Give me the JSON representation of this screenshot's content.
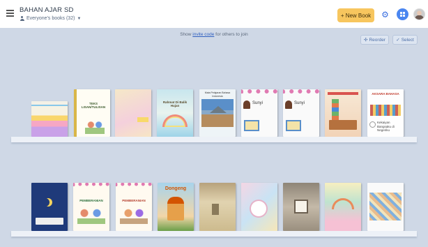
{
  "header": {
    "title": "BAHAN AJAR SD",
    "subtitle": "Everyone's books (32)",
    "new_book_label": "+ New Book"
  },
  "invite": {
    "prefix": "Show ",
    "link": "invite code",
    "suffix": " for others to join"
  },
  "toolbar": {
    "reorder_label": "Reorder",
    "select_label": "Select"
  },
  "shelves": [
    {
      "books": [
        {
          "title": ""
        },
        {
          "title": "TEKS LISAN/TULISAN"
        },
        {
          "title": ""
        },
        {
          "title": "Rahmat Di Balik Hujan"
        },
        {
          "title": "Mata Pelajaran Bahasa Indonesia"
        },
        {
          "title": "Sunyi"
        },
        {
          "title": "Sunyi"
        },
        {
          "title": ""
        },
        {
          "title": "AKSARA BAHASA"
        }
      ]
    },
    {
      "books": [
        {
          "title": ""
        },
        {
          "title": "PEMBERANIAN"
        },
        {
          "title": "PEMBERANIAN"
        },
        {
          "title": "Dongeng"
        },
        {
          "title": ""
        },
        {
          "title": ""
        },
        {
          "title": ""
        },
        {
          "title": ""
        },
        {
          "title": ""
        }
      ]
    }
  ],
  "extra_text": {
    "book_1_9_caption": "Kekaiyan Bangsaku di Negeriku"
  }
}
